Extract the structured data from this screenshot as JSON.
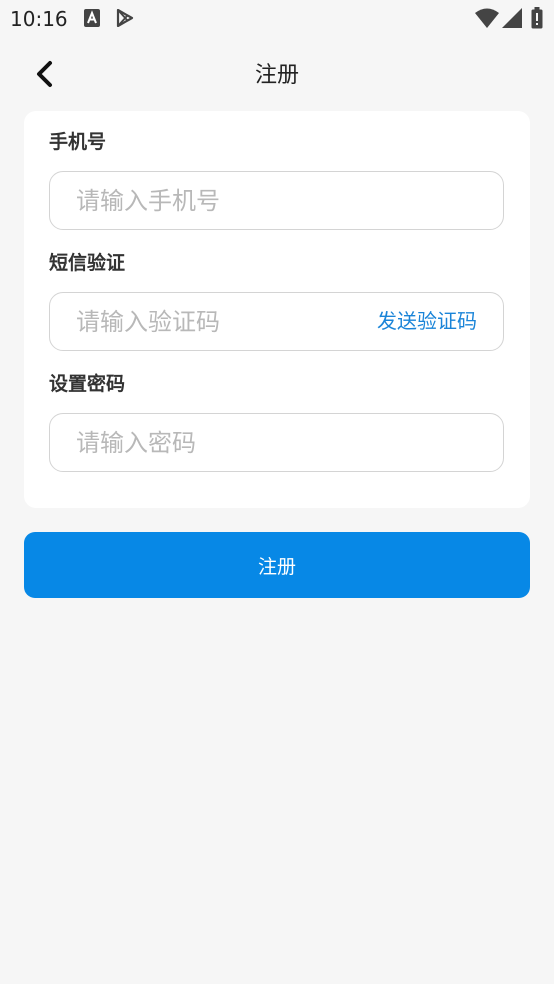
{
  "status_bar": {
    "time": "10:16",
    "icons": [
      "font-notification-icon",
      "play-store-icon",
      "wifi-icon",
      "signal-icon",
      "battery-icon"
    ]
  },
  "header": {
    "title": "注册",
    "back_icon": "chevron-left-icon"
  },
  "form": {
    "phone": {
      "label": "手机号",
      "placeholder": "请输入手机号",
      "value": ""
    },
    "sms": {
      "label": "短信验证",
      "placeholder": "请输入验证码",
      "value": "",
      "send_label": "发送验证码"
    },
    "password": {
      "label": "设置密码",
      "placeholder": "请输入密码",
      "value": ""
    }
  },
  "submit": {
    "label": "注册"
  },
  "colors": {
    "accent": "#0788e6",
    "link": "#1a84d8",
    "background": "#f6f6f6",
    "card": "#ffffff",
    "placeholder": "#b8b8b8"
  }
}
